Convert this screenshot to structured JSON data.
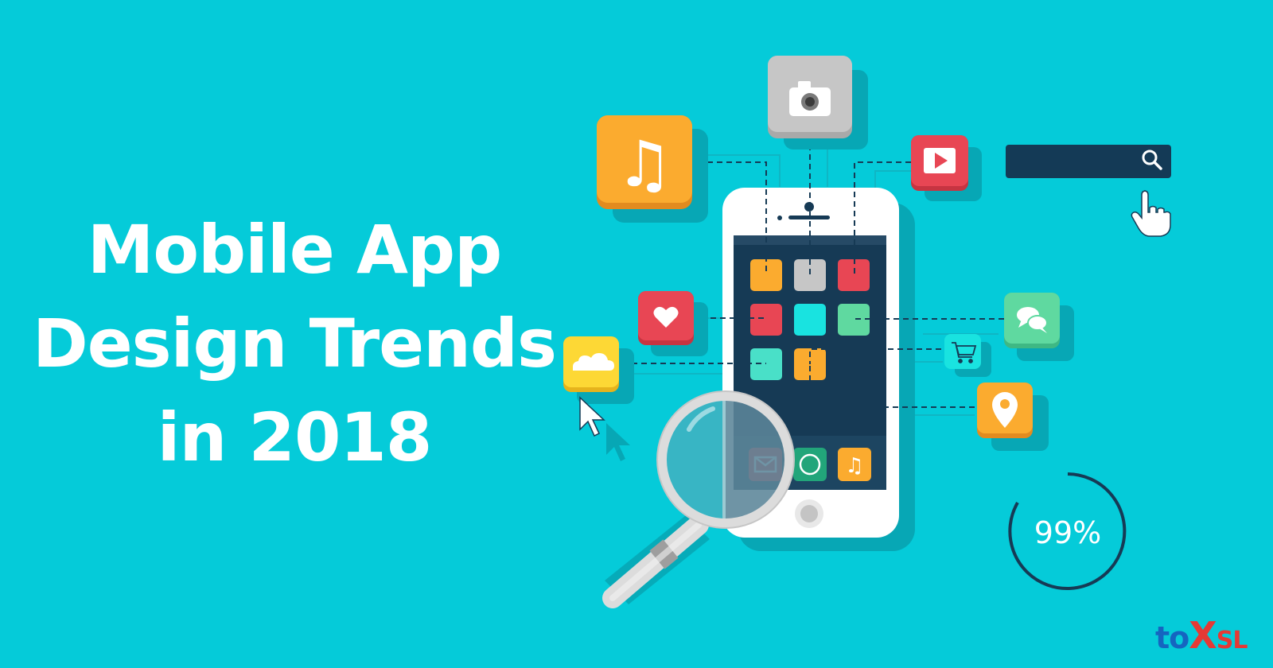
{
  "headline": {
    "line1": "Mobile App",
    "line2": "Design Trends",
    "line3": "in 2018"
  },
  "progress": {
    "label": "99%",
    "value": 0.99
  },
  "logo": {
    "part1": "to",
    "part2": "X",
    "part3": "SL",
    "colors": {
      "primary": "#1565c0",
      "accent": "#e53935"
    }
  },
  "colors": {
    "background": "#05cbd9",
    "phone_body": "#ffffff",
    "phone_screen": "#163a55",
    "orange": "#fbab2f",
    "red": "#e84654",
    "green": "#5fd9a0",
    "teal": "#19e3e0",
    "grey": "#c6c6c6",
    "yellow": "#fdd835",
    "search_bar": "#143a56"
  },
  "icons": {
    "music": "music-note-icon",
    "camera": "camera-icon",
    "video": "play-icon",
    "search": "search-icon",
    "pointer": "hand-pointer-icon",
    "heart": "heart-icon",
    "cloud": "cloud-icon",
    "chat": "chat-icon",
    "cart": "shopping-cart-icon",
    "location": "location-pin-icon",
    "cursor": "arrow-cursor-icon",
    "magnifier": "magnifying-glass-icon",
    "mail": "mail-icon",
    "phone": "phone-icon"
  }
}
